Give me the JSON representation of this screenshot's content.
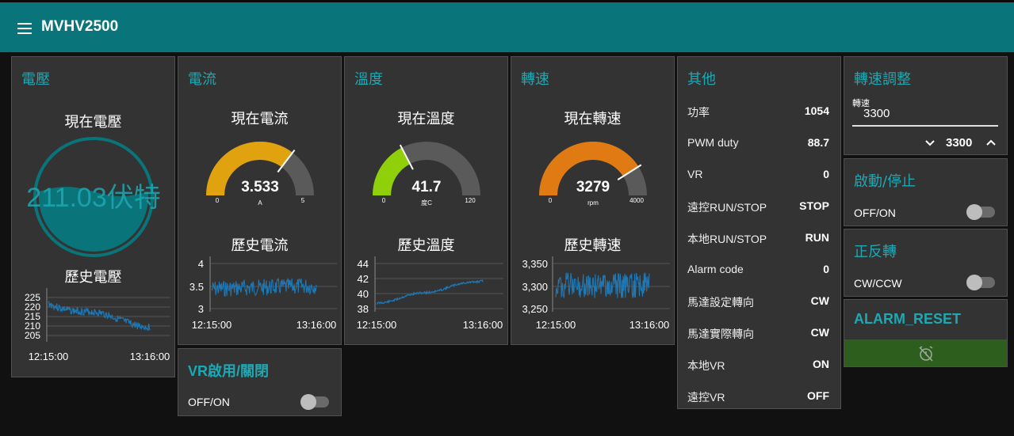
{
  "header": {
    "title": "MVHV2500"
  },
  "colors": {
    "accent": "#097479",
    "title": "#1fa8b3",
    "line": "#1f77b4",
    "gauge_current": "#e0a20e",
    "gauge_temp": "#8fd00a",
    "gauge_speed": "#e07a13",
    "reset_bg": "#2d5e1e"
  },
  "voltage": {
    "title": "電壓",
    "gauge_label": "現在電壓",
    "value_text": "211.03伏特",
    "level": 0.55,
    "chart_label": "歷史電壓",
    "chart_data": {
      "type": "line",
      "x_ticks": [
        "12:15:00",
        "13:16:00"
      ],
      "y_ticks": [
        "225",
        "220",
        "215",
        "210",
        "205"
      ],
      "ylim": [
        205,
        225
      ],
      "series_color": "#1f77b4"
    }
  },
  "current": {
    "title": "電流",
    "gauge_label": "現在電流",
    "value": "3.533",
    "unit": "A",
    "min": "0",
    "max": "5",
    "fraction": 0.7066,
    "chart_label": "歷史電流",
    "chart_data": {
      "type": "line",
      "x_ticks": [
        "12:15:00",
        "13:16:00"
      ],
      "y_ticks": [
        "4",
        "3.5",
        "3"
      ],
      "ylim": [
        3,
        4
      ]
    }
  },
  "temperature": {
    "title": "溫度",
    "gauge_label": "現在溫度",
    "value": "41.7",
    "unit": "度C",
    "min": "0",
    "max": "120",
    "fraction": 0.3475,
    "chart_label": "歷史溫度",
    "chart_data": {
      "type": "line",
      "x_ticks": [
        "12:15:00",
        "13:16:00"
      ],
      "y_ticks": [
        "44",
        "42",
        "40",
        "38"
      ],
      "ylim": [
        38,
        44
      ]
    }
  },
  "speed": {
    "title": "轉速",
    "gauge_label": "現在轉速",
    "value": "3279",
    "unit": "rpm",
    "min": "0",
    "max": "4000",
    "fraction": 0.81975,
    "chart_label": "歷史轉速",
    "chart_data": {
      "type": "line",
      "x_ticks": [
        "12:15:00",
        "13:16:00"
      ],
      "y_ticks": [
        "3,350",
        "3,300",
        "3,250"
      ],
      "ylim": [
        3250,
        3350
      ]
    }
  },
  "other": {
    "title": "其他",
    "rows": [
      {
        "k": "功率",
        "v": "1054"
      },
      {
        "k": "PWM duty",
        "v": "88.7"
      },
      {
        "k": "VR",
        "v": "0"
      },
      {
        "k": "遠控RUN/STOP",
        "v": "STOP"
      },
      {
        "k": "本地RUN/STOP",
        "v": "RUN"
      },
      {
        "k": "Alarm code",
        "v": "0"
      },
      {
        "k": "馬達設定轉向",
        "v": "CW"
      },
      {
        "k": "馬達實際轉向",
        "v": "CW"
      },
      {
        "k": "本地VR",
        "v": "ON"
      },
      {
        "k": "遠控VR",
        "v": "OFF"
      }
    ]
  },
  "speed_adjust": {
    "title": "轉速調整",
    "field_label": "轉速",
    "field_value": "3300",
    "stepper_value": "3300"
  },
  "start_stop": {
    "title": "啟動/停止",
    "label": "OFF/ON",
    "on": false
  },
  "direction": {
    "title": "正反轉",
    "label": "CW/CCW",
    "on": false
  },
  "alarm_reset": {
    "title": "ALARM_RESET",
    "icon": "alarm-off-icon"
  },
  "vr_switch": {
    "title": "VR啟用/關閉",
    "label": "OFF/ON",
    "on": false
  }
}
